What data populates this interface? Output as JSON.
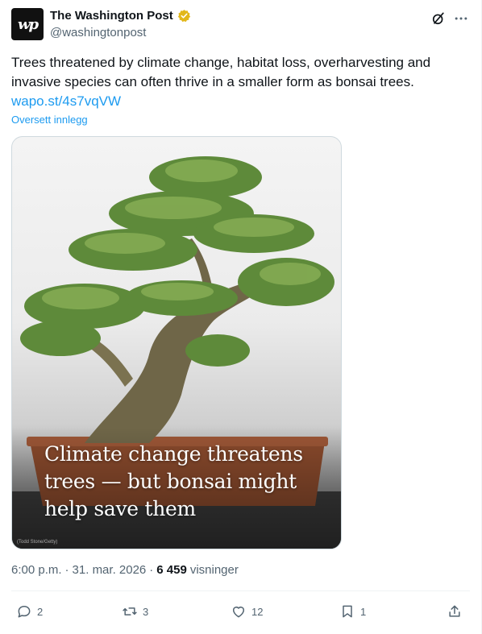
{
  "author": {
    "avatar_text": "wp",
    "name": "The Washington Post",
    "handle": "@washingtonpost",
    "verified_icon": "verified-badge-gold-icon"
  },
  "header_icons": {
    "grok": "grok-icon",
    "more": "more-icon"
  },
  "tweet": {
    "text": "Trees threatened by climate change, habitat loss, overharvesting and invasive species can often thrive in a smaller form as bonsai trees.",
    "link": "wapo.st/4s7vqVW",
    "translate": "Oversett innlegg"
  },
  "media": {
    "headline_line1": "Climate change threatens",
    "headline_line2": "trees — but bonsai might",
    "headline_line3": "help save them",
    "credit": "(Todd Stone/Getty)"
  },
  "meta": {
    "time": "6:00 p.m.",
    "separator1": "·",
    "date": "31. mar. 2026",
    "separator2": "·",
    "views_count": "6 459",
    "views_label": "visninger"
  },
  "actions": {
    "replies": "2",
    "reposts": "3",
    "likes": "12",
    "bookmarks": "1"
  },
  "colors": {
    "accent": "#1d9bf0",
    "secondary_text": "#536471",
    "verified": "#e2b719"
  }
}
